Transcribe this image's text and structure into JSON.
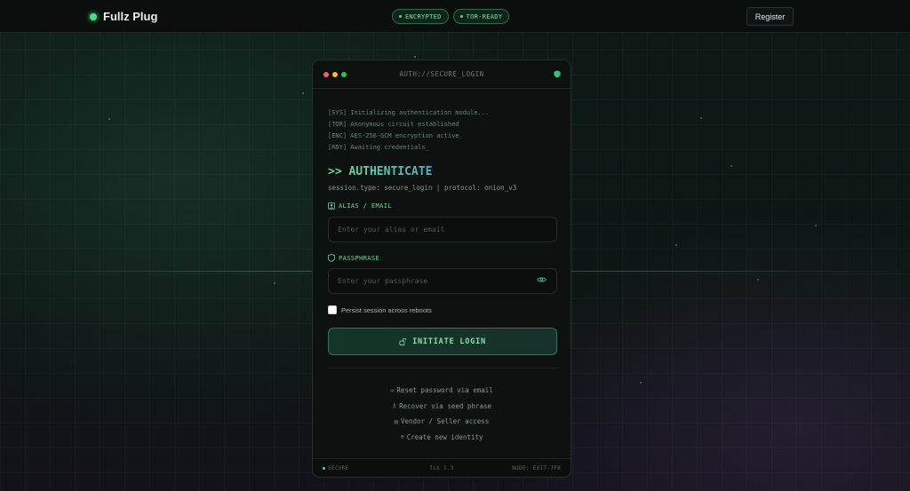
{
  "brand": {
    "name": "Fullz Plug"
  },
  "header": {
    "badges": [
      "ENCRYPTED",
      "TOR-READY"
    ],
    "register_label": "Register"
  },
  "card": {
    "title": "AUTH://SECURE_LOGIN",
    "log": [
      "[SYS] Initializing authentication module...",
      "[TOR] Anonymous circuit established",
      "[ENC] AES-256-GCM encryption active",
      "[RDY] Awaiting credentials_"
    ],
    "heading": ">> AUTHENTICATE",
    "session": "session.type: secure_login | protocol: onion_v3",
    "alias": {
      "label": "ALIAS / EMAIL",
      "placeholder": "Enter your alias or email"
    },
    "passphrase": {
      "label": "PASSPHRASE",
      "placeholder": "Enter your passphrase"
    },
    "remember_label": "Persist session across reboots",
    "login_label": "INITIATE LOGIN",
    "links": [
      {
        "icon": "✉",
        "label": "Reset password via email"
      },
      {
        "icon": "⚷",
        "label": "Recover via seed phrase"
      },
      {
        "icon": "▤",
        "label": "Vendor / Seller access"
      },
      {
        "icon": "⊕",
        "label": "Create new identity"
      }
    ],
    "footer": {
      "status": "SECURE",
      "tls": "TLS 1.3",
      "node": "NODE: EXIT-7F8"
    }
  },
  "colors": {
    "accent": "#4ade80",
    "accent_text": "#7ee6a9"
  }
}
